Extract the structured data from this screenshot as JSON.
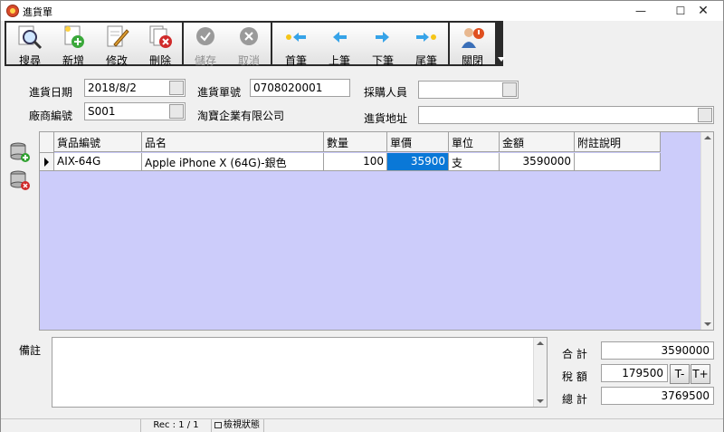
{
  "window": {
    "title": "進貨單"
  },
  "toolbar": {
    "search": "搜尋",
    "add": "新增",
    "edit": "修改",
    "delete": "刪除",
    "save": "儲存",
    "cancel": "取消",
    "first": "首筆",
    "prev": "上筆",
    "next": "下筆",
    "last": "尾筆",
    "close": "關閉"
  },
  "form": {
    "date_label": "進貨日期",
    "date_value": "2018/8/2",
    "order_no_label": "進貨單號",
    "order_no_value": "0708020001",
    "buyer_label": "採購人員",
    "buyer_value": "",
    "vendor_code_label": "廠商編號",
    "vendor_code_value": "S001",
    "vendor_name": "淘寶企業有限公司",
    "address_label": "進貨地址",
    "address_value": ""
  },
  "grid": {
    "columns": [
      "貨品編號",
      "品名",
      "數量",
      "單價",
      "單位",
      "金額",
      "附註說明"
    ],
    "rows": [
      {
        "code": "AIX-64G",
        "name": "Apple iPhone X (64G)-銀色",
        "qty": "100",
        "price": "35900",
        "unit": "支",
        "amount": "3590000",
        "note": ""
      }
    ]
  },
  "memo": {
    "label": "備註",
    "value": ""
  },
  "totals": {
    "subtotal_label": "合 計",
    "subtotal_value": "3590000",
    "tax_label": "稅 額",
    "tax_value": "179500",
    "tax_minus": "T-",
    "tax_plus": "T+",
    "total_label": "總 計",
    "total_value": "3769500"
  },
  "status": {
    "rec": "Rec : 1 / 1",
    "mode": "檢視狀態"
  }
}
